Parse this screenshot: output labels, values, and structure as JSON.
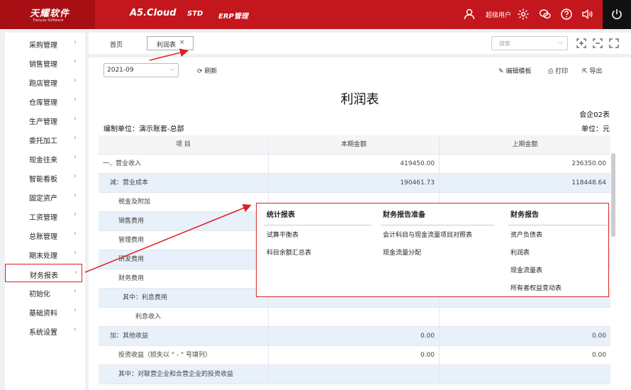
{
  "header": {
    "logo_text": "天耀软件",
    "logo_sub": "Tianyao Software",
    "nav": [
      "A5.Cloud",
      "STD",
      "ERP管理"
    ],
    "user_label": "超级用户"
  },
  "sidebar": {
    "items": [
      {
        "label": "采购管理",
        "chevron": true
      },
      {
        "label": "销售管理",
        "chevron": true
      },
      {
        "label": "跑店管理",
        "chevron": true
      },
      {
        "label": "仓库管理",
        "chevron": true
      },
      {
        "label": "生产管理",
        "chevron": true
      },
      {
        "label": "委托加工",
        "chevron": true
      },
      {
        "label": "现金往来",
        "chevron": true
      },
      {
        "label": "智能看板",
        "chevron": true
      },
      {
        "label": "固定资产",
        "chevron": true
      },
      {
        "label": "工资管理",
        "chevron": true
      },
      {
        "label": "总账管理",
        "chevron": true
      },
      {
        "label": "期末处理",
        "chevron": true
      },
      {
        "label": "财务报表",
        "chevron": true,
        "active": true
      },
      {
        "label": "初始化",
        "chevron": true
      },
      {
        "label": "基础资料",
        "chevron": true
      },
      {
        "label": "系统设置",
        "chevron": true
      }
    ]
  },
  "tabs": {
    "home": "首页",
    "active": "利润表",
    "close": "×",
    "search_placeholder": "搜索"
  },
  "toolbar": {
    "period": "2021-09",
    "refresh": "刷新",
    "edit_template": "编辑模板",
    "print": "打印",
    "export": "导出"
  },
  "report": {
    "title": "利润表",
    "code": "会企02表",
    "unit_company": "编制单位：演示账套-总部",
    "unit_currency": "单位：元",
    "columns": [
      "项  目",
      "本期金额",
      "上期金额"
    ],
    "rows": [
      {
        "item": "一、营业收入",
        "current": "419450.00",
        "previous": "236350.00",
        "indent": 6
      },
      {
        "item": "减：营业成本",
        "current": "190461.73",
        "previous": "118448.64",
        "indent": 16
      },
      {
        "item": "税金及附加",
        "current": "",
        "previous": "",
        "indent": 28
      },
      {
        "item": "销售费用",
        "current": "",
        "previous": "",
        "indent": 28
      },
      {
        "item": "管理费用",
        "current": "",
        "previous": "",
        "indent": 28
      },
      {
        "item": "研发费用",
        "current": "",
        "previous": "",
        "indent": 28
      },
      {
        "item": "财务费用",
        "current": "",
        "previous": "",
        "indent": 28
      },
      {
        "item": "其中：利息费用",
        "current": "",
        "previous": "",
        "indent": 34
      },
      {
        "item": "利息收入",
        "current": "",
        "previous": "",
        "indent": 52
      },
      {
        "item": "加：其他收益",
        "current": "0.00",
        "previous": "0.00",
        "indent": 16
      },
      {
        "item": "投资收益（损失以 \" - \" 号填列）",
        "current": "0.00",
        "previous": "0.00",
        "indent": 28
      },
      {
        "item": "其中：对联营企业和合营企业的投资收益",
        "current": "",
        "previous": "",
        "indent": 28
      }
    ]
  },
  "popup": {
    "columns": [
      {
        "title": "统计报表",
        "items": [
          "试算平衡表",
          "科目余额汇总表"
        ]
      },
      {
        "title": "财务报告准备",
        "items": [
          "会计科目与现金流量项目对照表",
          "现金流量分配"
        ]
      },
      {
        "title": "财务报告",
        "items": [
          "资产负债表",
          "利润表",
          "现金流量表",
          "所有者权益变动表"
        ]
      }
    ]
  },
  "colors": {
    "brand_red": "#c3161d",
    "highlight_red": "#e02020",
    "row_alt": "#e8f1f9"
  }
}
